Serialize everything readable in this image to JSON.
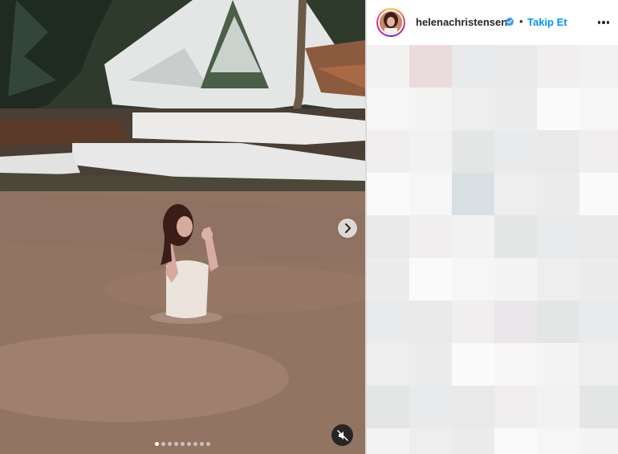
{
  "post": {
    "username": "helenachristensen",
    "separator": "•",
    "follow_label": "Takip Et",
    "verified": true,
    "carousel": {
      "total_slides": 9,
      "active_slide": 1
    },
    "icons": {
      "verified": "verified-badge-icon",
      "more": "more-options-icon",
      "next": "chevron-right-icon",
      "mute": "muted-speaker-icon"
    },
    "colors": {
      "follow": "#0095f6",
      "text": "#262626",
      "divider": "#dbdbdb"
    }
  }
}
